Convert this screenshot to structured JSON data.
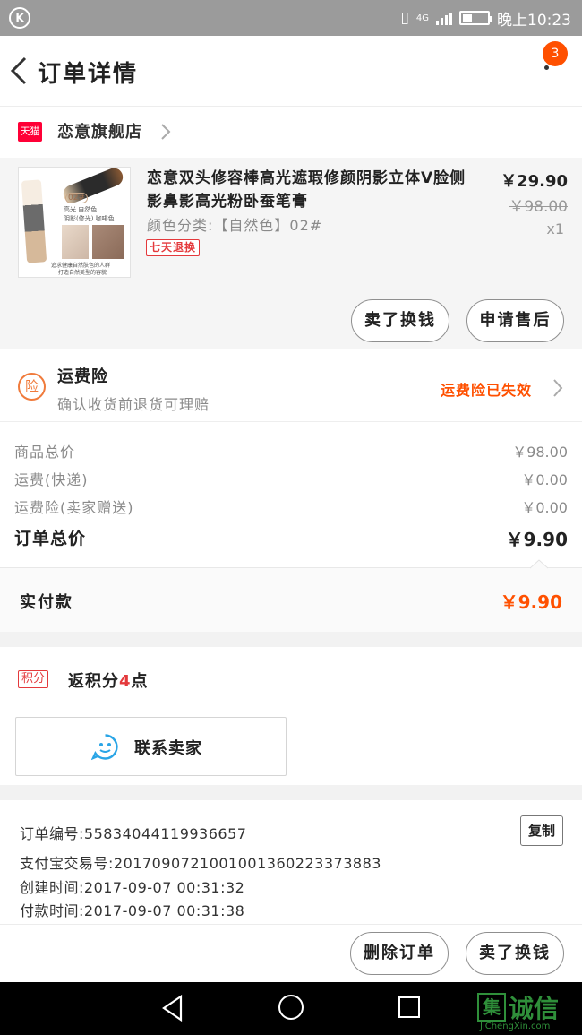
{
  "status_bar": {
    "time": "晚上10:23",
    "network": "4G"
  },
  "nav": {
    "title": "订单详情",
    "badge_count": "3"
  },
  "shop": {
    "platform_logo": "天猫",
    "name": "恋意旗舰店"
  },
  "product": {
    "title": "恋意双头修容棒高光遮瑕修颜阴影立体V脸侧影鼻影高光粉卧蚕笔膏",
    "sku": "颜色分类:【自然色】02#",
    "tag": "七天退换",
    "price": "￥29.90",
    "original_price": "￥98.00",
    "quantity": "x1",
    "thumb": {
      "code": "02#",
      "line1": "高光 自然色",
      "line2": "阴影(修光) 咖啡色",
      "caption1": "追求健康自然肤色的人群",
      "caption2": "打造自然美型的容貌"
    },
    "buttons": {
      "exchange": "卖了换钱",
      "aftersale": "申请售后"
    }
  },
  "insurance": {
    "icon_text": "险",
    "title": "运费险",
    "desc": "确认收货前退货可理赔",
    "status": "运费险已失效"
  },
  "summary": {
    "rows": [
      {
        "label": "商品总价",
        "value": "￥98.00"
      },
      {
        "label": "运费(快递)",
        "value": "￥0.00"
      },
      {
        "label": "运费险(卖家赠送)",
        "value": "￥0.00"
      }
    ],
    "total_label": "订单总价",
    "total_value": "￥9.90"
  },
  "payment": {
    "label": "实付款",
    "value": "￥9.90"
  },
  "points": {
    "tag": "积分",
    "prefix": "返积分",
    "amount": "4",
    "suffix": "点"
  },
  "contact": {
    "label": "联系卖家"
  },
  "order_info": {
    "lines": [
      "订单编号:55834044119936657",
      "支付宝交易号:2017090721001001360223373883",
      "创建时间:2017-09-07 00:31:32",
      "付款时间:2017-09-07 00:31:38"
    ],
    "copy_label": "复制"
  },
  "footer": {
    "delete": "删除订单",
    "exchange": "卖了换钱"
  },
  "watermark": {
    "mark": "集",
    "name": "诚信",
    "url": "JiChengXin.com"
  },
  "colors": {
    "accent": "#ff5000",
    "tag_red": "#e4393c",
    "tmall": "#ff0036"
  }
}
